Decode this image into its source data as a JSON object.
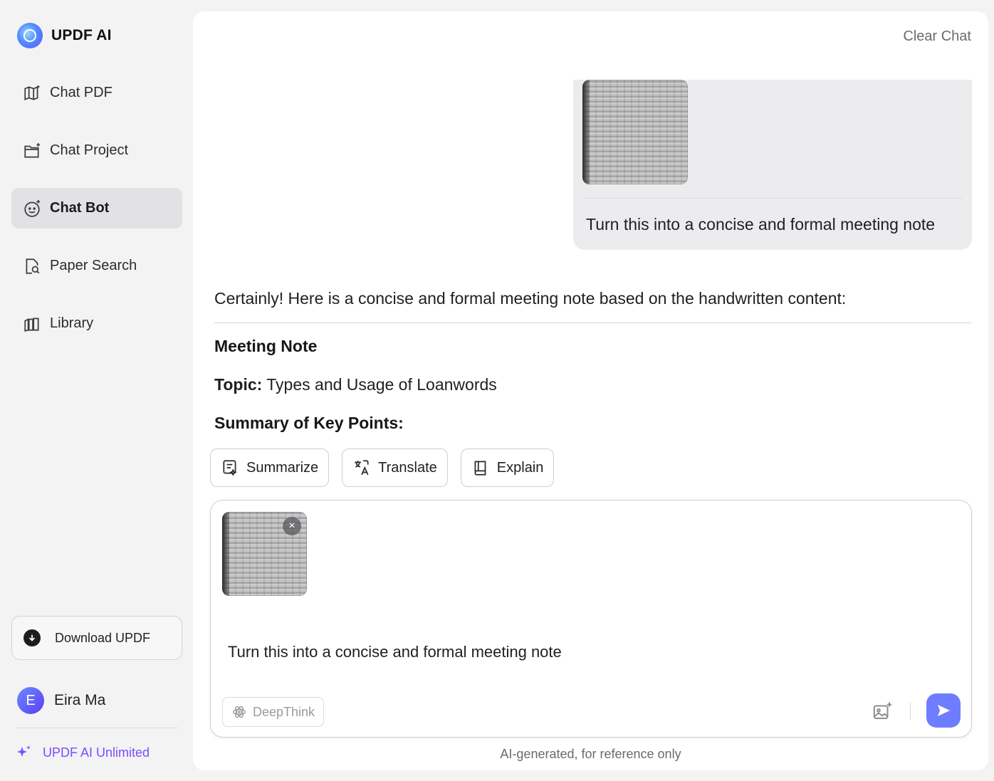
{
  "brand": {
    "name": "UPDF AI",
    "accent": "#6e7dff"
  },
  "sidebar": {
    "items": [
      {
        "label": "Chat PDF",
        "icon": "book-ai-icon",
        "active": false
      },
      {
        "label": "Chat Project",
        "icon": "folder-ai-icon",
        "active": false
      },
      {
        "label": "Chat Bot",
        "icon": "bot-face-icon",
        "active": true
      },
      {
        "label": "Paper Search",
        "icon": "paper-search-icon",
        "active": false
      },
      {
        "label": "Library",
        "icon": "library-icon",
        "active": false
      }
    ],
    "download_label": "Download UPDF",
    "user": {
      "initial": "E",
      "name": "Eira Ma"
    },
    "plan_label": "UPDF AI Unlimited"
  },
  "main": {
    "clear_chat_label": "Clear Chat",
    "user_message": {
      "text": "Turn this into a concise and formal meeting note"
    },
    "ai_response": {
      "intro": "Certainly! Here is a concise and formal meeting note based on the handwritten content:",
      "heading": "Meeting Note",
      "topic_label": "Topic:",
      "topic_value": "Types and Usage of Loanwords",
      "summary_heading": "Summary of Key Points:"
    },
    "quick_actions": [
      {
        "label": "Summarize",
        "icon": "summarize-icon"
      },
      {
        "label": "Translate",
        "icon": "translate-icon"
      },
      {
        "label": "Explain",
        "icon": "book-icon"
      }
    ],
    "composer": {
      "value": "Turn this into a concise and formal meeting note",
      "deepthink_label": "DeepThink",
      "remove_symbol": "×"
    },
    "disclaimer": "AI-generated, for reference only"
  }
}
